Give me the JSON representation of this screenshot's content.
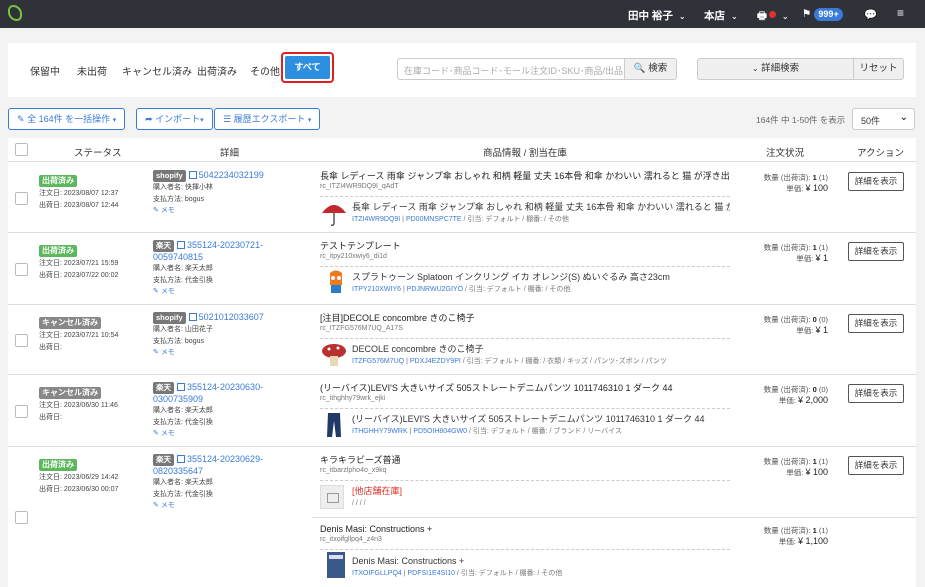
{
  "topbar": {
    "user": "田中 裕子",
    "store": "本店",
    "notif_count": "999+"
  },
  "filters": {
    "tabs": [
      "保留中",
      "未出荷",
      "キャンセル済み",
      "出荷済み",
      "その他"
    ],
    "active": "すべて"
  },
  "search": {
    "placeholder": "在庫コード･商品コード･モール注文ID･SKU･商品/出品タイトル",
    "button": "検索",
    "advanced": "詳細検索",
    "reset": "リセット"
  },
  "actions": {
    "bulk": "全 164件 を一括操作",
    "import": "インポート",
    "export": "履歴エクスポート"
  },
  "pagination": {
    "summary": "164件 中 1-50件 を表示",
    "per_page": "50件"
  },
  "table": {
    "headers": {
      "status": "ステータス",
      "detail": "詳細",
      "product": "商品情報 / 割当在庫",
      "order_status": "注文状況",
      "action": "アクション"
    }
  },
  "labels": {
    "ordered": "注文日:",
    "shipped": "出荷日:",
    "buyer": "購入者名:",
    "payment": "支払方法:",
    "memo": "メモ",
    "qty": "数量 (出荷済):",
    "unit": "単価:",
    "detail_btn": "詳細を表示",
    "other_store": "[他店舗在庫]"
  },
  "orders": [
    {
      "status": "出荷済み",
      "status_type": "shipped",
      "ordered": "2023/08/07 12:37",
      "shipped": "2023/08/07 12:44",
      "mall": "shopify",
      "order_no": "5042234032199",
      "buyer": "快揮小林",
      "payment": "bogus",
      "product": "長傘 レディース 雨傘 ジャンプ傘 おしゃれ 和柄 軽量 丈夫 16本骨 和傘 かわいい 濡れると 猫 が浮き出る 特殊生地",
      "product_code": "rc_ITZI4WR9DQ9I_qAdT",
      "sku": "長傘 レディース 雨傘 ジャンプ傘 おしゃれ 和柄 軽量 丈夫 16本骨 和傘 かわいい 濡れると 猫 が浮き出る",
      "sku_code": "ITZI4WR9DQ9I",
      "sku_link": "PD00MNSPC7TE",
      "sku_path": " / 引当: デフォルト / 棚番:  / その他",
      "qty": "1",
      "qty_shipped": "(1)",
      "price": "¥ 100"
    },
    {
      "status": "出荷済み",
      "status_type": "shipped",
      "ordered": "2023/07/21 15:59",
      "shipped": "2023/07/22 00:02",
      "mall": "楽天",
      "order_no": "355124-20230721-0059740815",
      "buyer": "楽天太郎",
      "payment": "代金引換",
      "product": "テストテンプレート",
      "product_code": "rc_itpy210xwiy6_di1d",
      "sku": "スプラトゥーン Splatoon インクリング イカ オレンジ(S) ぬいぐるみ 高さ23cm",
      "sku_code": "ITPY210XWIY6",
      "sku_link": "PDJNRWU2GIYO",
      "sku_path": " / 引当: デフォルト / 棚番:  / その他",
      "qty": "1",
      "qty_shipped": "(1)",
      "price": "¥ 1"
    },
    {
      "status": "キャンセル済み",
      "status_type": "cancel",
      "ordered": "2023/07/21 10:54",
      "shipped": "",
      "mall": "shopify",
      "order_no": "5021012033607",
      "buyer": "山田花子",
      "payment": "bogus",
      "product": "[注目]DECOLE concombre きのこ椅子",
      "product_code": "rc_ITZFG576M7UQ_A17S",
      "sku": "DECOLE concombre きのこ椅子",
      "sku_code": "ITZFG576M7UQ",
      "sku_link": "PDXJ4EZDY9PI",
      "sku_path": " / 引当: デフォルト / 棚番:  / 衣類 / キッズ / パンツ･ズボン / パンツ",
      "qty": "0",
      "qty_shipped": "(0)",
      "price": "¥ 1"
    },
    {
      "status": "キャンセル済み",
      "status_type": "cancel",
      "ordered": "2023/06/30 11:46",
      "shipped": "",
      "mall": "楽天",
      "order_no": "355124-20230630-0300735909",
      "buyer": "楽天太郎",
      "payment": "代金引換",
      "product": "(リーバイス)LEVI'S 大きいサイズ 505ストレートデニムパンツ 1011746310 1 ダーク 44",
      "product_code": "rc_ithghhy79wrk_ejki",
      "sku": "(リーバイス)LEVI'S 大きいサイズ 505ストレートデニムパンツ 1011746310 1 ダーク 44",
      "sku_code": "ITHGHHY79WRK",
      "sku_link": "PD5OIH804GW0",
      "sku_path": " / 引当: デフォルト / 棚番:  / ブランド / リーバイス",
      "qty": "0",
      "qty_shipped": "(0)",
      "price": "¥ 2,000"
    },
    {
      "status": "出荷済み",
      "status_type": "shipped",
      "ordered": "2023/06/29 14:42",
      "shipped": "2023/06/30 00:07",
      "mall": "楽天",
      "order_no": "355124-20230629-0820335647",
      "buyer": "楽天太郎",
      "payment": "代金引換",
      "product": "キラキラビーズ普通",
      "product_code": "rc_itbarzlpho4o_x9kq",
      "sku_path": " /  /  /  /",
      "qty": "1",
      "qty_shipped": "(1)",
      "price": "¥ 100",
      "product2": "Denis Masi: Constructions +",
      "product2_code": "rc_itxoifgllpq4_z4n3",
      "sku2": "Denis Masi: Constructions +",
      "sku2_code": "ITXOIFGLLPQ4",
      "sku2_link": "PDFSI1E4SI10",
      "sku2_path": " / 引当: デフォルト / 棚番:  / その他",
      "qty2": "1",
      "qty2_shipped": "(1)",
      "price2": "¥ 1,100"
    }
  ]
}
